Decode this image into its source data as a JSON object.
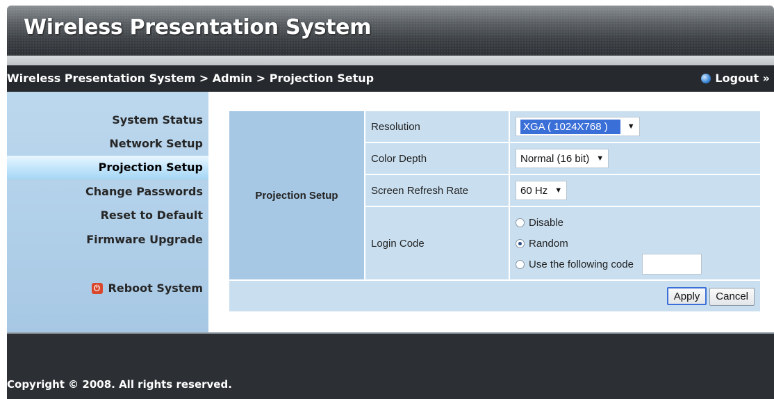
{
  "header": {
    "title": "Wireless Presentation System"
  },
  "breadcrumb": {
    "text": "Wireless Presentation System > Admin > Projection Setup"
  },
  "logout": {
    "label": "Logout »"
  },
  "sidebar": {
    "items": [
      {
        "label": "System Status"
      },
      {
        "label": "Network Setup"
      },
      {
        "label": "Projection Setup"
      },
      {
        "label": "Change Passwords"
      },
      {
        "label": "Reset to Default"
      },
      {
        "label": "Firmware Upgrade"
      }
    ],
    "reboot_label": "Reboot System"
  },
  "form": {
    "section_title": "Projection Setup",
    "resolution": {
      "label": "Resolution",
      "value": "XGA ( 1024X768 )"
    },
    "color_depth": {
      "label": "Color Depth",
      "value": "Normal (16 bit)"
    },
    "refresh_rate": {
      "label": "Screen Refresh Rate",
      "value": "60 Hz"
    },
    "login_code": {
      "label": "Login Code",
      "options": [
        {
          "label": "Disable",
          "selected": false
        },
        {
          "label": "Random",
          "selected": true
        },
        {
          "label": "Use the following code",
          "selected": false
        }
      ],
      "code_value": ""
    },
    "apply_label": "Apply",
    "cancel_label": "Cancel"
  },
  "footer": {
    "copyright": "Copyright © 2008. All rights reserved."
  }
}
